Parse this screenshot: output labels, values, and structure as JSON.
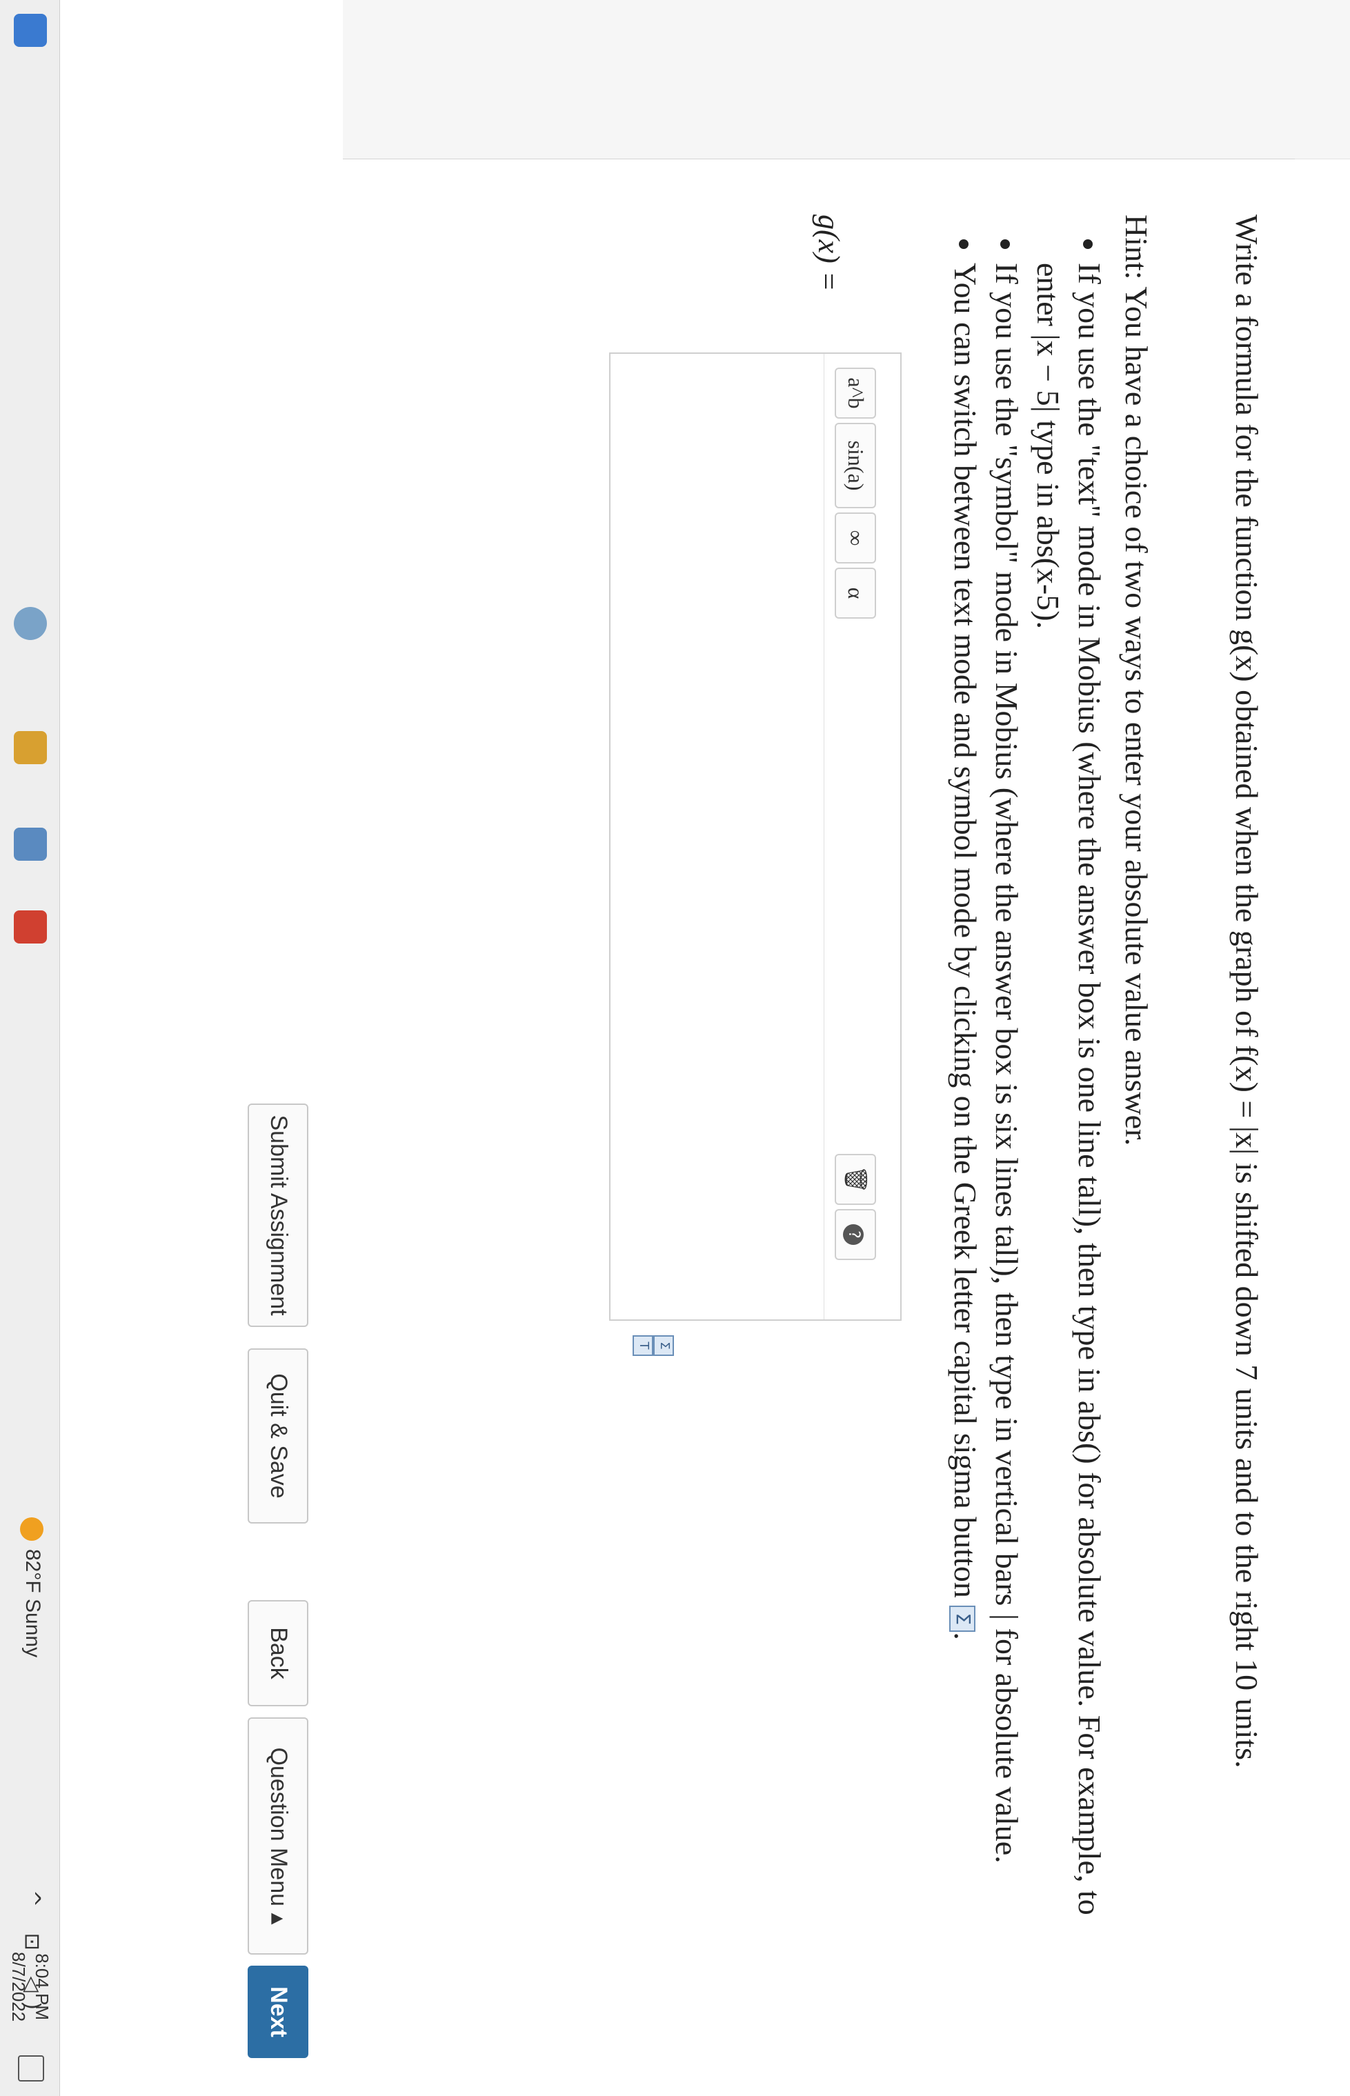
{
  "question": {
    "text": "Write a formula for the function g(x) obtained when the graph of f(x) = |x| is shifted down 7 units and to the right 10 units."
  },
  "hint": {
    "intro": "Hint: You have a choice of two ways to enter your absolute value answer.",
    "items": [
      "If you use the \"text\" mode in Mobius (where the answer box is one line tall), then type in abs() for absolute value. For example, to enter |x − 5| type in abs(x-5).",
      "If you use the \"symbol\" mode in Mobius (where the answer box is six lines tall), then type in vertical bars | for absolute value.",
      "You can switch between text mode and symbol mode by clicking on the Greek letter capital sigma button"
    ],
    "sigma_glyph": "Σ",
    "period": "."
  },
  "answer": {
    "label": "g(x) =",
    "value": ""
  },
  "toolbar": {
    "power": "a^b",
    "sin": "sin(a)",
    "infinity": "∞",
    "alpha": "α",
    "trash": "🗑",
    "help": "?"
  },
  "mode_toggle": {
    "sigma": "Σ",
    "text": "T"
  },
  "buttons": {
    "submit": "Submit Assignment",
    "quit": "Quit & Save",
    "back": "Back",
    "question_menu": "Question Menu ▴",
    "next": "Next"
  },
  "taskbar": {
    "weather": "82°F Sunny",
    "tray": "^ ⊡ ◁)",
    "time": "8:04 PM",
    "date": "8/7/2022"
  }
}
